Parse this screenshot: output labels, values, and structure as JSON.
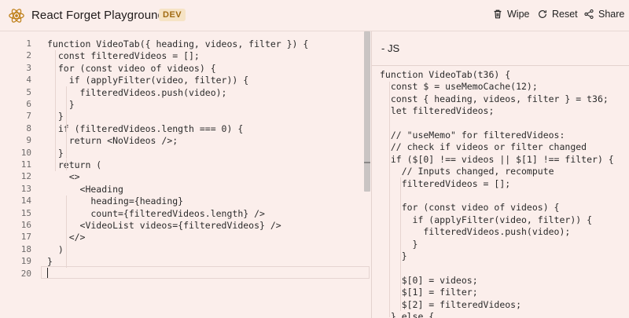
{
  "header": {
    "title": "React Forget Playground",
    "badge": "DEV",
    "wipe_label": "Wipe",
    "reset_label": "Reset",
    "share_label": "Share",
    "icons": [
      "react-logo-icon",
      "trash-icon",
      "reset-icon",
      "share-icon"
    ]
  },
  "editor": {
    "lines": [
      {
        "n": "1",
        "text": "function VideoTab({ heading, videos, filter }) {"
      },
      {
        "n": "2",
        "text": "  const filteredVideos = [];"
      },
      {
        "n": "3",
        "text": "  for (const video of videos) {"
      },
      {
        "n": "4",
        "text": "    if (applyFilter(video, filter)) {"
      },
      {
        "n": "5",
        "text": "      filteredVideos.push(video);"
      },
      {
        "n": "6",
        "text": "    }"
      },
      {
        "n": "7",
        "text": "  }"
      },
      {
        "n": "8",
        "text": "  if (filteredVideos.length === 0) {"
      },
      {
        "n": "9",
        "text": "    return <NoVideos />;"
      },
      {
        "n": "10",
        "text": "  }"
      },
      {
        "n": "11",
        "text": "  return ("
      },
      {
        "n": "12",
        "text": "    <>"
      },
      {
        "n": "13",
        "text": "      <Heading"
      },
      {
        "n": "14",
        "text": "        heading={heading}"
      },
      {
        "n": "15",
        "text": "        count={filteredVideos.length} />"
      },
      {
        "n": "16",
        "text": "      <VideoList videos={filteredVideos} />"
      },
      {
        "n": "17",
        "text": "    </>"
      },
      {
        "n": "18",
        "text": "  )"
      },
      {
        "n": "19",
        "text": "}"
      },
      {
        "n": "20",
        "text": ""
      }
    ]
  },
  "output": {
    "tab_label": "- JS",
    "lines": [
      "function VideoTab(t36) {",
      "  const $ = useMemoCache(12);",
      "  const { heading, videos, filter } = t36;",
      "  let filteredVideos;",
      "",
      "  // \"useMemo\" for filteredVideos:",
      "  // check if videos or filter changed",
      "  if ($[0] !== videos || $[1] !== filter) {",
      "    // Inputs changed, recompute",
      "    filteredVideos = [];",
      "",
      "    for (const video of videos) {",
      "      if (applyFilter(video, filter)) {",
      "        filteredVideos.push(video);",
      "      }",
      "    }",
      "",
      "    $[0] = videos;",
      "    $[1] = filter;",
      "    $[2] = filteredVideos;",
      "  } else {"
    ]
  },
  "colors": {
    "background": "#fbeeeb",
    "keyword": "#0b4ea2",
    "comment": "#2a6a1f",
    "tag": "#0f7d8a",
    "badge": "#a06a12"
  }
}
